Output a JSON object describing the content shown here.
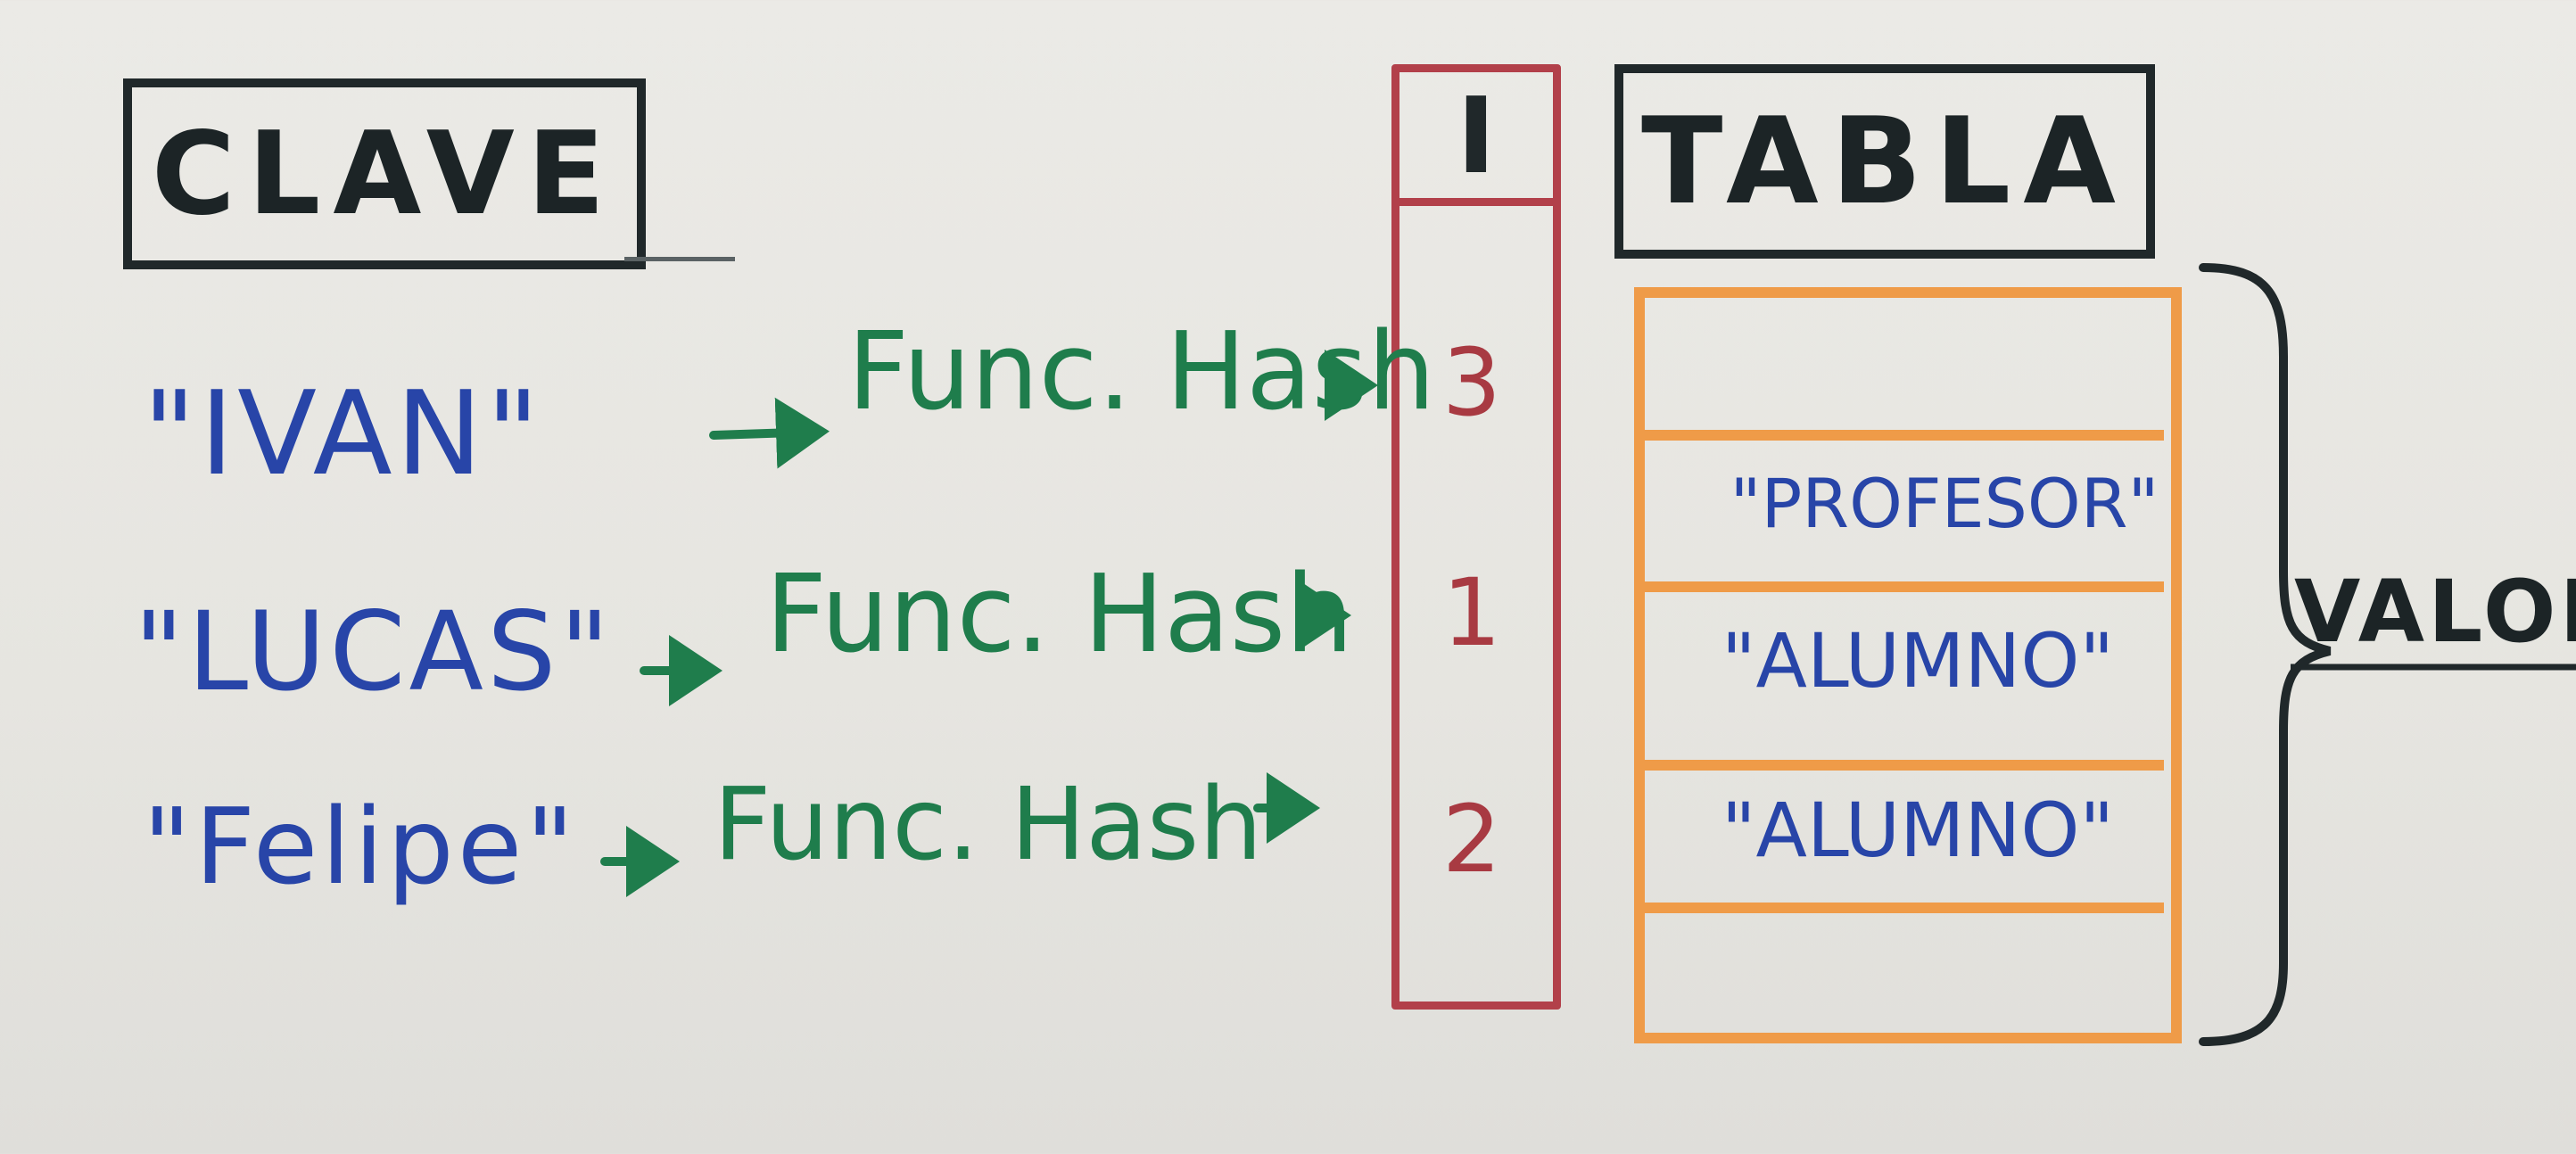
{
  "headers": {
    "clave": "CLAVE",
    "indice": "I",
    "tabla": "TABLA"
  },
  "rows": [
    {
      "key": "\"IVAN\"",
      "hash": "Func. Hash",
      "index": "3"
    },
    {
      "key": "\"LUCAS\"",
      "hash": "Func. Hash",
      "index": "1"
    },
    {
      "key": "\"Felipe\"",
      "hash": "Func. Hash",
      "index": "2"
    }
  ],
  "table_values": [
    "",
    "\"PROFESOR\"",
    "\"ALUMNO\"",
    "\"ALUMNO\"",
    ""
  ],
  "brace_label": "VALOR",
  "colors": {
    "ink_black": "#20282a",
    "key_blue": "#2845a8",
    "hash_green": "#1f7d4c",
    "index_red": "#a83a42",
    "table_orange": "#ef9b48"
  }
}
